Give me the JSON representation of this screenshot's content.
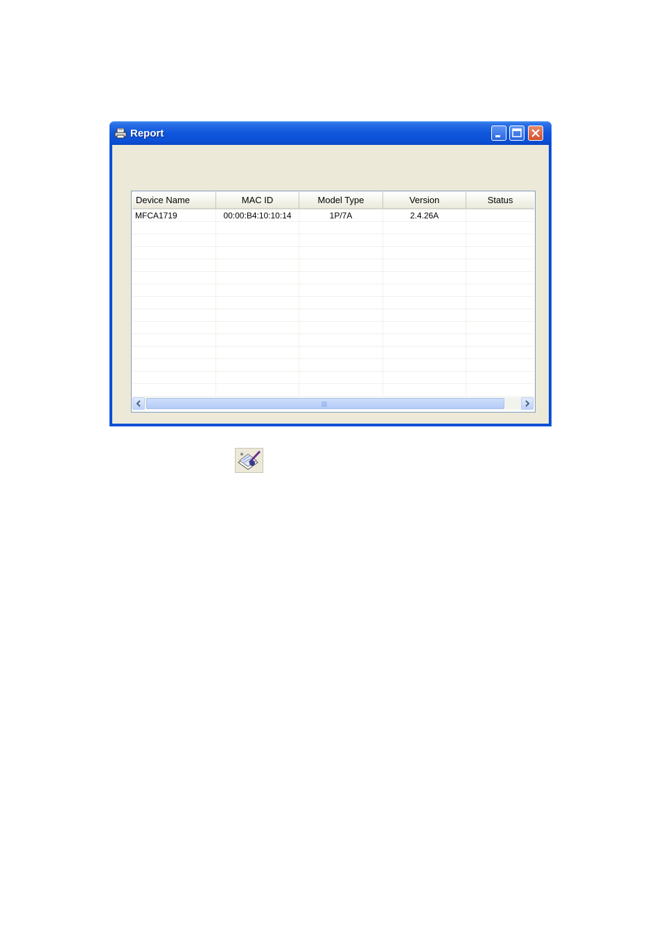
{
  "window": {
    "title": "Report",
    "icon": "printer-icon",
    "controls": [
      "minimize-icon",
      "maximize-icon",
      "close-icon"
    ]
  },
  "table": {
    "columns": [
      "Device Name",
      "MAC ID",
      "Model Type",
      "Version",
      "Status"
    ],
    "rows": [
      [
        "MFCA1719",
        "00:00:B4:10:10:14",
        "1P/7A",
        "2.4.26A",
        ""
      ]
    ],
    "empty_rows": 14
  },
  "scrollbar": {
    "left_icon": "chevron-left-icon",
    "right_icon": "chevron-right-icon"
  },
  "toolbar_icon": "report-edit-icon",
  "colors": {
    "titlebar": "#0a4fd6",
    "client": "#ece9d8",
    "close_button": "#d1502e"
  }
}
